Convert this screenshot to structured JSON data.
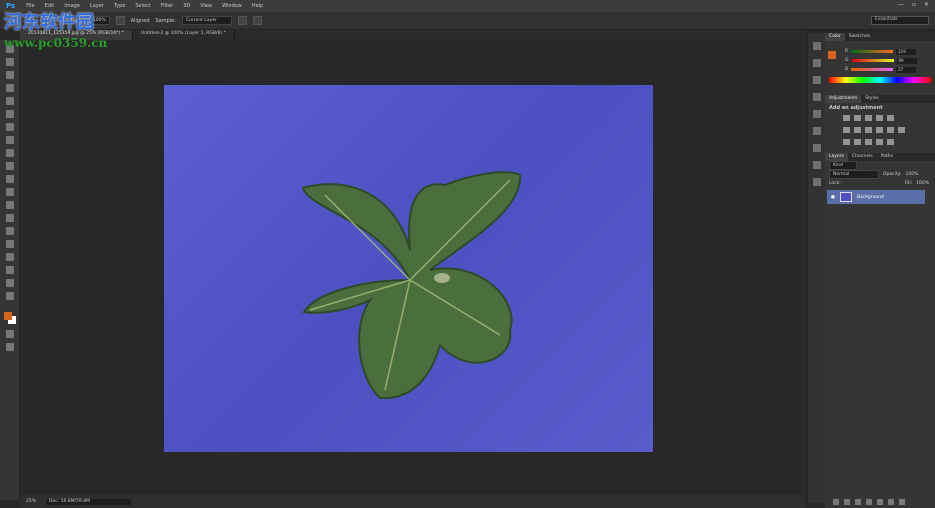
{
  "app": {
    "logo": "Ps",
    "menu": [
      "File",
      "Edit",
      "Image",
      "Layer",
      "Type",
      "Select",
      "Filter",
      "3D",
      "View",
      "Window",
      "Help"
    ],
    "window_controls": [
      "—",
      "▫",
      "✕"
    ]
  },
  "options": {
    "flow_label": "Flow:",
    "flow_value": "100%",
    "aligned_label": "Aligned",
    "sample_label": "Sample:",
    "sample_value": "Current Layer",
    "workspace": "Essentials"
  },
  "tabs": [
    {
      "label": "20130811_125359.jpg @ 25% (RGB/16*) *"
    },
    {
      "label": "Untitled-2 @ 100% (Layer 1, RGB/8) *"
    }
  ],
  "status": {
    "zoom": "25%",
    "doc": "Doc: 59.8M/59.8M"
  },
  "color_panel": {
    "tabs": [
      "Color",
      "Swatches"
    ],
    "r": "219",
    "g": "99",
    "b": "27"
  },
  "adjustments": {
    "tabs": [
      "Adjustments",
      "Styles"
    ],
    "heading": "Add an adjustment"
  },
  "layers_panel": {
    "tabs": [
      "Layers",
      "Channels",
      "Paths"
    ],
    "kind": "Kind",
    "blend": "Normal",
    "opacity_label": "Opacity:",
    "opacity": "100%",
    "lock_label": "Lock:",
    "fill_label": "Fill:",
    "fill": "100%",
    "layer_name": "Background"
  },
  "watermark": {
    "title": "河东软件园",
    "url": "www.pc0359.cn"
  },
  "colors": {
    "foreground": "#db631b",
    "background": "#ffffff",
    "canvas_blue": "#5255c6",
    "leaf": "#4a6e3c"
  }
}
